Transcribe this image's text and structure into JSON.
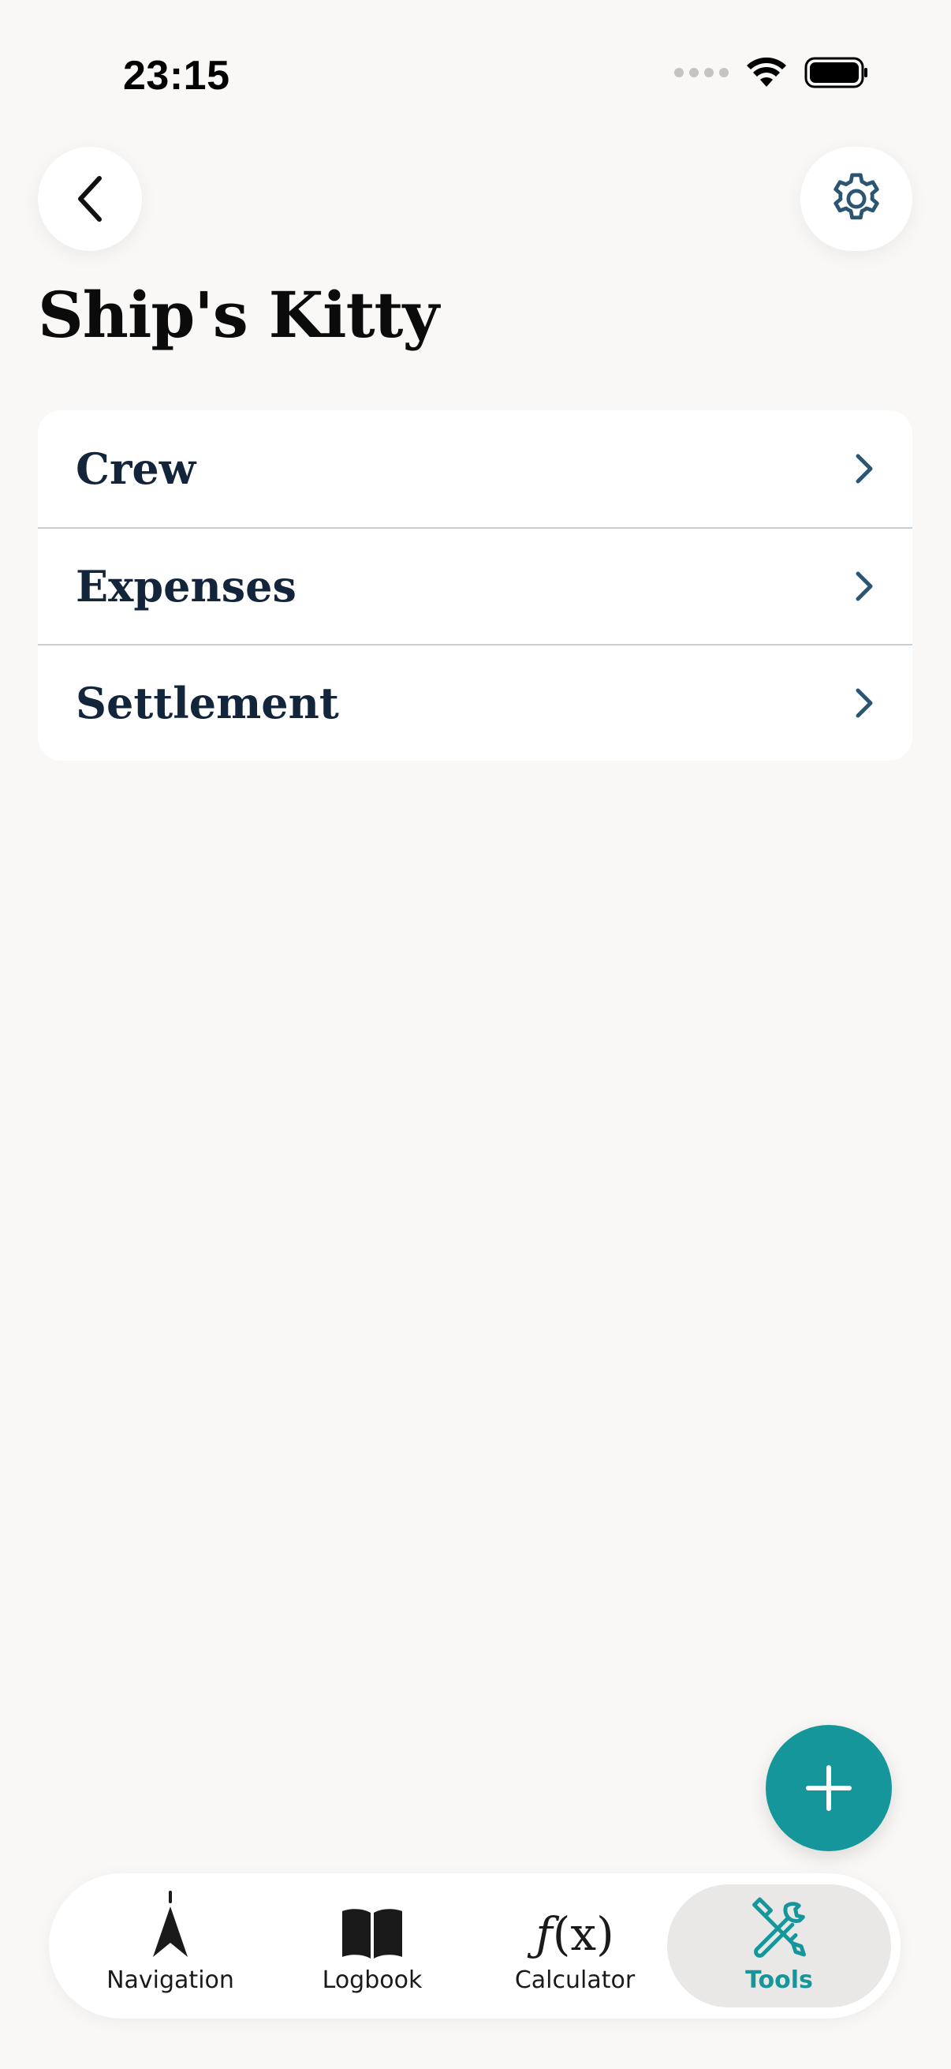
{
  "status_bar": {
    "time": "23:15",
    "icons": [
      "cellular-signal-icon",
      "wifi-icon",
      "battery-icon"
    ]
  },
  "header": {
    "back_icon": "chevron-left-icon",
    "settings_icon": "gear-icon",
    "title": "Ship's Kitty"
  },
  "menu": {
    "items": [
      {
        "label": "Crew",
        "icon": "chevron-right-icon"
      },
      {
        "label": "Expenses",
        "icon": "chevron-right-icon"
      },
      {
        "label": "Settlement",
        "icon": "chevron-right-icon"
      }
    ]
  },
  "fab": {
    "icon": "plus-icon"
  },
  "tab_bar": {
    "tabs": [
      {
        "label": "Navigation",
        "icon": "compass-arrow-icon",
        "selected": false
      },
      {
        "label": "Logbook",
        "icon": "book-icon",
        "selected": false
      },
      {
        "label": "Calculator",
        "icon": "function-icon",
        "selected": false
      },
      {
        "label": "Tools",
        "icon": "tools-icon",
        "selected": true
      }
    ]
  },
  "colors": {
    "accent": "#15969a",
    "background": "#f9f8f6",
    "row_text": "#13253b"
  }
}
